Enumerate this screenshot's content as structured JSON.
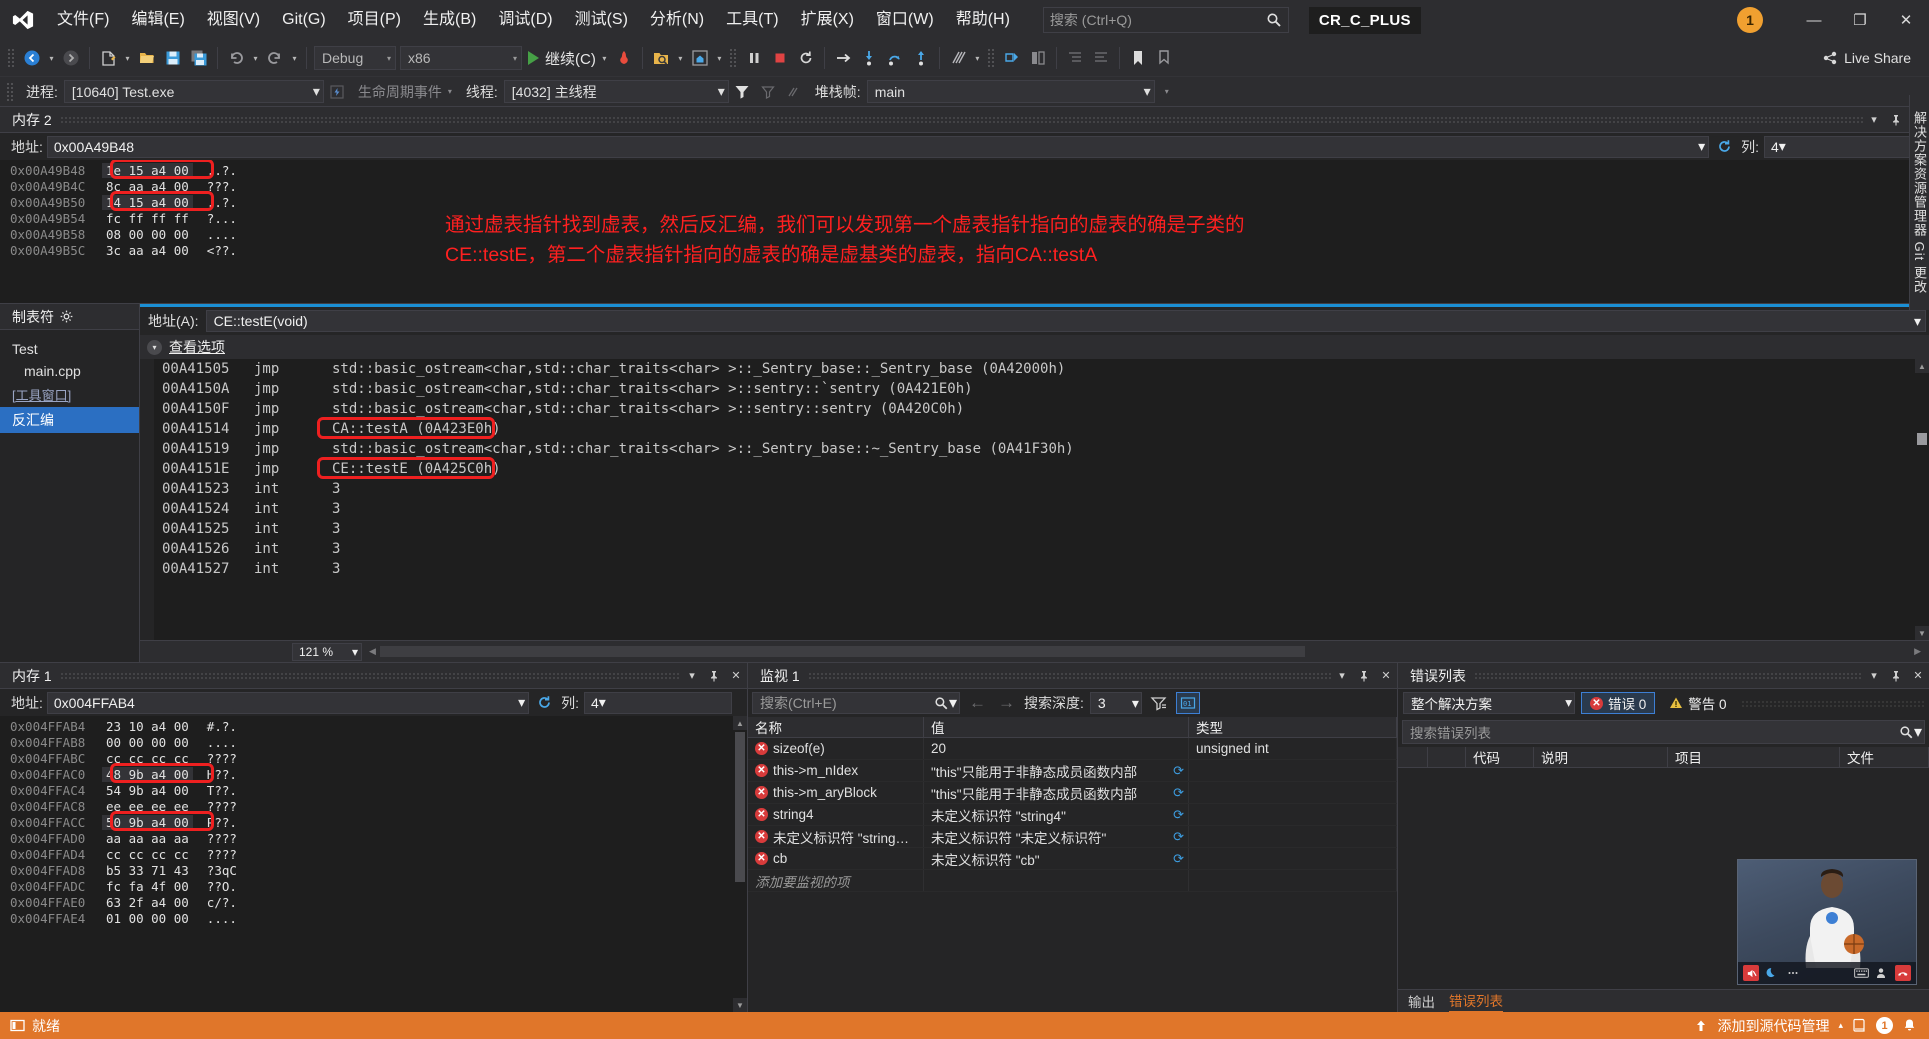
{
  "titlebar": {
    "logo_icon": "visual-studio-logo",
    "menus": [
      "文件(F)",
      "编辑(E)",
      "视图(V)",
      "Git(G)",
      "项目(P)",
      "生成(B)",
      "调试(D)",
      "测试(S)",
      "分析(N)",
      "工具(T)",
      "扩展(X)",
      "窗口(W)",
      "帮助(H)"
    ],
    "search_placeholder": "搜索 (Ctrl+Q)",
    "search_icon": "search-icon",
    "project_tag": "CR_C_PLUS",
    "notification_count": "1",
    "minimize": "—",
    "restore": "❐",
    "close": "✕"
  },
  "toolbar": {
    "nav_back_icon": "navigate-back-icon",
    "nav_forward_icon": "navigate-forward-icon",
    "new_icon": "new-file-icon",
    "open_icon": "open-folder-icon",
    "save_icon": "save-icon",
    "save_all_icon": "save-all-icon",
    "undo_icon": "undo-icon",
    "redo_icon": "redo-icon",
    "config": "Debug",
    "platform": "x86",
    "continue_label": "继续(C)",
    "hot_reload_icon": "hot-reload-icon",
    "search_folder_icon": "search-in-folder-icon",
    "home_icon": "home-icon",
    "pause_icon": "pause-icon",
    "stop_icon": "stop-icon",
    "restart_icon": "restart-icon",
    "show_next_icon": "show-next-statement-icon",
    "step_into_icon": "step-into-icon",
    "step_over_icon": "step-over-icon",
    "step_out_icon": "step-out-icon",
    "threads_icon": "threads-icon",
    "breakpoint_icon": "breakpoint-icon",
    "live_share_label": "Live Share",
    "live_share_icon": "live-share-icon"
  },
  "debugbar": {
    "process_label": "进程:",
    "process_value": "[10640] Test.exe",
    "lifecycle_icon": "lifecycle-events-icon",
    "lifecycle_label": "生命周期事件",
    "thread_label": "线程:",
    "thread_value": "[4032] 主线程",
    "filter_icon": "filter-icon",
    "stackframe_label": "堆栈帧:",
    "stackframe_value": "main"
  },
  "memory2": {
    "title": "内存 2",
    "address_label": "地址:",
    "address_value": "0x00A49B48",
    "refresh_icon": "refresh-icon",
    "column_label": "列:",
    "column_value": "4",
    "dropdown_icon": "chevron-down-icon",
    "pin_icon": "pin-icon",
    "close_icon": "close-icon",
    "rows": [
      {
        "addr": "0x00A49B48",
        "bytes": "1e 15 a4 00",
        "ascii": "..?.",
        "highlight": true
      },
      {
        "addr": "0x00A49B4C",
        "bytes": "8c aa a4 00",
        "ascii": "???.",
        "highlight": false
      },
      {
        "addr": "0x00A49B50",
        "bytes": "14 15 a4 00",
        "ascii": "..?.",
        "highlight": true
      },
      {
        "addr": "0x00A49B54",
        "bytes": "fc ff ff ff",
        "ascii": "?...",
        "highlight": false
      },
      {
        "addr": "0x00A49B58",
        "bytes": "08 00 00 00",
        "ascii": "....",
        "highlight": false
      },
      {
        "addr": "0x00A49B5C",
        "bytes": "3c aa a4 00",
        "ascii": "<??.",
        "highlight": false
      }
    ],
    "annotation_line1": "通过虚表指针找到虚表，然后反汇编，我们可以发现第一个虚表指针指向的虚表的确是子类的",
    "annotation_line2": "CE::testE，第二个虚表指针指向的虚表的确是虚基类的虚表，指向CA::testA",
    "annotation_color": "#ff2020"
  },
  "right_rail": {
    "text": "解决方案资源管理器    Git 更改"
  },
  "disasm": {
    "left_header": "制表符",
    "left_gear_icon": "gear-icon",
    "left_items": [
      {
        "label": "Test",
        "indent": false,
        "link": false,
        "selected": false
      },
      {
        "label": "main.cpp",
        "indent": true,
        "link": false,
        "selected": false
      },
      {
        "label": "[工具窗口]",
        "indent": false,
        "link": true,
        "selected": false
      },
      {
        "label": "反汇编",
        "indent": false,
        "link": false,
        "selected": true
      }
    ],
    "address_label": "地址(A):",
    "address_value": "CE::testE(void)",
    "view_options_label": "查看选项",
    "chevron_icon": "chevron-down-icon",
    "lines": [
      {
        "addr": "00A41505",
        "mn": "jmp",
        "op": "std::basic_ostream<char,std::char_traits<char> >::_Sentry_base::_Sentry_base (0A42000h)",
        "box": false
      },
      {
        "addr": "00A4150A",
        "mn": "jmp",
        "op": "std::basic_ostream<char,std::char_traits<char> >::sentry::`sentry (0A421E0h)",
        "box": false
      },
      {
        "addr": "00A4150F",
        "mn": "jmp",
        "op": "std::basic_ostream<char,std::char_traits<char> >::sentry::sentry (0A420C0h)",
        "box": false
      },
      {
        "addr": "00A41514",
        "mn": "jmp",
        "op": "CA::testA (0A423E0h)",
        "box": true
      },
      {
        "addr": "00A41519",
        "mn": "jmp",
        "op": "std::basic_ostream<char,std::char_traits<char> >::_Sentry_base::~_Sentry_base (0A41F30h)",
        "box": false
      },
      {
        "addr": "00A4151E",
        "mn": "jmp",
        "op": "CE::testE (0A425C0h)",
        "box": true
      },
      {
        "addr": "00A41523",
        "mn": "int",
        "op": "3",
        "box": false
      },
      {
        "addr": "00A41524",
        "mn": "int",
        "op": "3",
        "box": false
      },
      {
        "addr": "00A41525",
        "mn": "int",
        "op": "3",
        "box": false
      },
      {
        "addr": "00A41526",
        "mn": "int",
        "op": "3",
        "box": false
      },
      {
        "addr": "00A41527",
        "mn": "int",
        "op": "3",
        "box": false
      }
    ],
    "zoom_value": "121 %"
  },
  "memory1": {
    "title": "内存 1",
    "address_label": "地址:",
    "address_value": "0x004FFAB4",
    "refresh_icon": "refresh-icon",
    "column_label": "列:",
    "column_value": "4",
    "rows": [
      {
        "addr": "0x004FFAB4",
        "bytes": "23 10 a4 00",
        "ascii": "#.?.",
        "highlight": false
      },
      {
        "addr": "0x004FFAB8",
        "bytes": "00 00 00 00",
        "ascii": "....",
        "highlight": false
      },
      {
        "addr": "0x004FFABC",
        "bytes": "cc cc cc cc",
        "ascii": "????",
        "highlight": false
      },
      {
        "addr": "0x004FFAC0",
        "bytes": "48 9b a4 00",
        "ascii": "H??.",
        "highlight": true
      },
      {
        "addr": "0x004FFAC4",
        "bytes": "54 9b a4 00",
        "ascii": "T??.",
        "highlight": false
      },
      {
        "addr": "0x004FFAC8",
        "bytes": "ee ee ee ee",
        "ascii": "????",
        "highlight": false
      },
      {
        "addr": "0x004FFACC",
        "bytes": "50 9b a4 00",
        "ascii": "P??.",
        "highlight": true
      },
      {
        "addr": "0x004FFAD0",
        "bytes": "aa aa aa aa",
        "ascii": "????",
        "highlight": false
      },
      {
        "addr": "0x004FFAD4",
        "bytes": "cc cc cc cc",
        "ascii": "????",
        "highlight": false
      },
      {
        "addr": "0x004FFAD8",
        "bytes": "b5 33 71 43",
        "ascii": "?3qC",
        "highlight": false
      },
      {
        "addr": "0x004FFADC",
        "bytes": "fc fa 4f 00",
        "ascii": "??O.",
        "highlight": false
      },
      {
        "addr": "0x004FFAE0",
        "bytes": "63 2f a4 00",
        "ascii": "c/?.",
        "highlight": false
      },
      {
        "addr": "0x004FFAE4",
        "bytes": "01 00 00 00",
        "ascii": "....",
        "highlight": false
      }
    ]
  },
  "watch": {
    "title": "监视 1",
    "search_placeholder": "搜索(Ctrl+E)",
    "search_icon": "search-icon",
    "back_icon": "arrow-left-icon",
    "forward_icon": "arrow-right-icon",
    "depth_label": "搜索深度:",
    "depth_value": "3",
    "filter_icon": "filter-icon",
    "hex_icon": "hex-display-icon",
    "columns": [
      "名称",
      "值",
      "类型"
    ],
    "rows": [
      {
        "name": "sizeof(e)",
        "value": "20",
        "type": "unsigned int",
        "error": true,
        "refresh": false
      },
      {
        "name": "this->m_nIdex",
        "value": "\"this\"只能用于非静态成员函数内部",
        "type": "",
        "error": true,
        "refresh": true
      },
      {
        "name": "this->m_aryBlock",
        "value": "\"this\"只能用于非静态成员函数内部",
        "type": "",
        "error": true,
        "refresh": true
      },
      {
        "name": "string4",
        "value": "未定义标识符 \"string4\"",
        "type": "",
        "error": true,
        "refresh": true
      },
      {
        "name": "未定义标识符 \"string…",
        "value": "未定义标识符 \"未定义标识符\"",
        "type": "",
        "error": true,
        "refresh": true
      },
      {
        "name": "cb",
        "value": "未定义标识符 \"cb\"",
        "type": "",
        "error": true,
        "refresh": true
      }
    ],
    "add_row_label": "添加要监视的项"
  },
  "errorlist": {
    "title": "错误列表",
    "scope_value": "整个解决方案",
    "errors_label": "错误 0",
    "warnings_label": "警告 0",
    "error_icon": "error-icon",
    "warning_icon": "warning-icon",
    "search_placeholder": "搜索错误列表",
    "columns": [
      "",
      "",
      "代码",
      "说明",
      "项目",
      "文件"
    ],
    "tabs": [
      {
        "label": "输出",
        "selected": false
      },
      {
        "label": "错误列表",
        "selected": true
      }
    ]
  },
  "statusbar": {
    "ready_icon": "ready-icon",
    "ready_label": "就绪",
    "source_control_label": "添加到源代码管理",
    "upload_icon": "upload-icon",
    "repo_icon": "repo-icon",
    "notification_count": "1",
    "bell_icon": "bell-icon"
  },
  "video_overlay": {
    "mute_icon": "mute-icon",
    "moon_icon": "moon-icon",
    "keyboard_icon": "keyboard-icon",
    "person_icon": "person-icon",
    "more_icon": "more-icon"
  }
}
